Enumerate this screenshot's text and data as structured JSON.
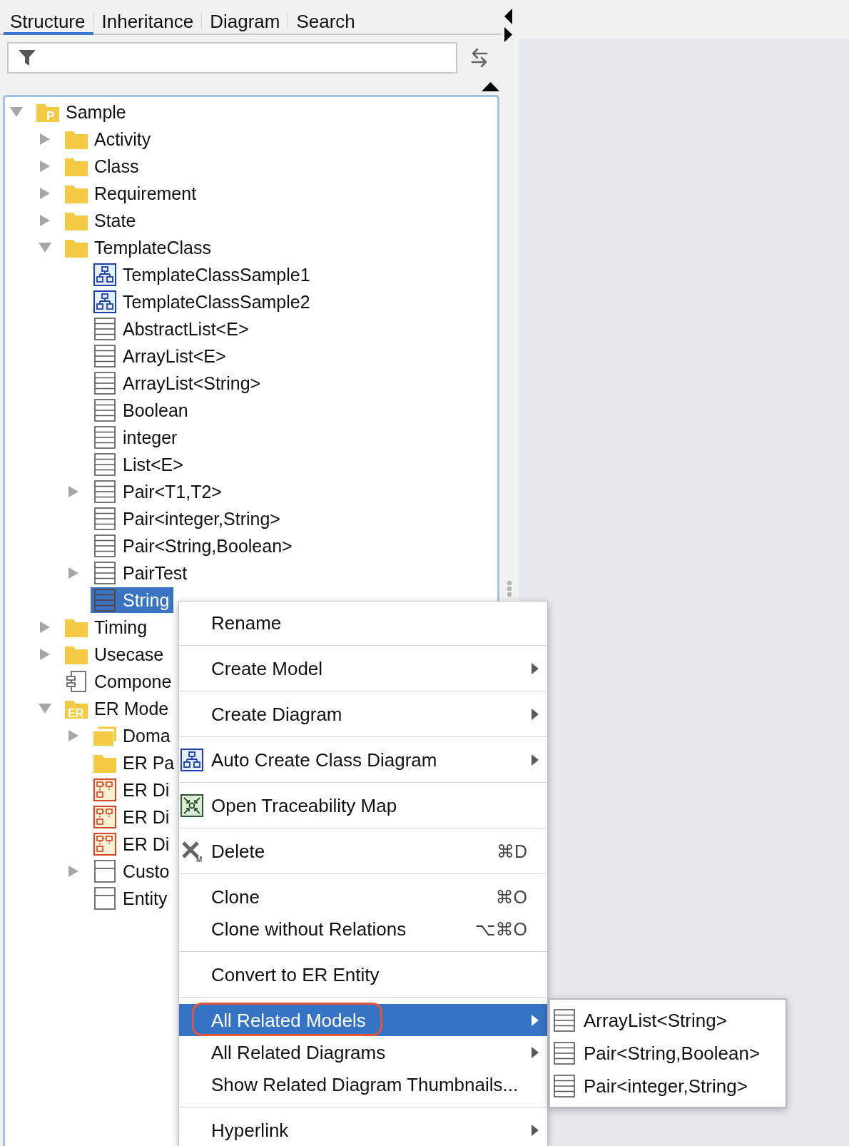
{
  "tabs": [
    {
      "label": "Structure",
      "selected": true
    },
    {
      "label": "Inheritance",
      "selected": false
    },
    {
      "label": "Diagram",
      "selected": false
    },
    {
      "label": "Search",
      "selected": false
    }
  ],
  "tree": [
    {
      "label": "Sample",
      "kind": "project",
      "icon_text": "P",
      "expanded": true,
      "selected": false,
      "children": [
        {
          "label": "Activity",
          "kind": "folder",
          "expanded": false,
          "selected": false
        },
        {
          "label": "Class",
          "kind": "folder",
          "expanded": false,
          "selected": false
        },
        {
          "label": "Requirement",
          "kind": "folder",
          "expanded": false,
          "selected": false
        },
        {
          "label": "State",
          "kind": "folder",
          "expanded": false,
          "selected": false
        },
        {
          "label": "TemplateClass",
          "kind": "folder",
          "expanded": true,
          "selected": false,
          "children": [
            {
              "label": "TemplateClassSample1",
              "kind": "diagram",
              "selected": false
            },
            {
              "label": "TemplateClassSample2",
              "kind": "diagram",
              "selected": false
            },
            {
              "label": "AbstractList<E>",
              "kind": "class",
              "selected": false
            },
            {
              "label": "ArrayList<E>",
              "kind": "class",
              "selected": false
            },
            {
              "label": "ArrayList<String>",
              "kind": "class",
              "selected": false
            },
            {
              "label": "Boolean",
              "kind": "class",
              "selected": false
            },
            {
              "label": "integer",
              "kind": "class",
              "selected": false
            },
            {
              "label": "List<E>",
              "kind": "class",
              "selected": false
            },
            {
              "label": "Pair<T1,T2>",
              "kind": "class",
              "expanded": false,
              "selected": false
            },
            {
              "label": "Pair<integer,String>",
              "kind": "class",
              "selected": false
            },
            {
              "label": "Pair<String,Boolean>",
              "kind": "class",
              "selected": false
            },
            {
              "label": "PairTest",
              "kind": "class",
              "expanded": false,
              "selected": false
            },
            {
              "label": "String",
              "kind": "class",
              "selected": true
            }
          ]
        },
        {
          "label": "Timing",
          "kind": "folder",
          "expanded": false,
          "selected": false
        },
        {
          "label": "Usecase",
          "kind": "folder",
          "expanded": false,
          "selected": false
        },
        {
          "label": "Compone",
          "kind": "component",
          "selected": false
        },
        {
          "label": "ER Mode",
          "kind": "ermodel",
          "icon_text": "ER",
          "expanded": true,
          "selected": false,
          "children": [
            {
              "label": "Doma",
              "kind": "domain",
              "expanded": false,
              "selected": false
            },
            {
              "label": "ER Pa",
              "kind": "folder",
              "selected": false
            },
            {
              "label": "ER Di",
              "kind": "erdiagram",
              "selected": false
            },
            {
              "label": "ER Di",
              "kind": "erdiagram",
              "selected": false
            },
            {
              "label": "ER Di",
              "kind": "erdiagram",
              "selected": false
            },
            {
              "label": "Custo",
              "kind": "entity",
              "expanded": false,
              "selected": false
            },
            {
              "label": "Entity",
              "kind": "entity",
              "selected": false
            }
          ]
        }
      ]
    }
  ],
  "context_menu": {
    "groups": [
      {
        "items": [
          {
            "label": "Rename",
            "kind": "plain",
            "submenu": false,
            "selected": false,
            "circled": false
          }
        ]
      },
      {
        "items": [
          {
            "label": "Create Model",
            "kind": "plain",
            "submenu": true,
            "selected": false,
            "circled": false
          }
        ]
      },
      {
        "items": [
          {
            "label": "Create Diagram",
            "kind": "plain",
            "submenu": true,
            "selected": false,
            "circled": false
          }
        ]
      },
      {
        "items": [
          {
            "label": "Auto Create Class Diagram",
            "kind": "diagram",
            "submenu": true,
            "selected": false,
            "circled": false
          }
        ]
      },
      {
        "items": [
          {
            "label": "Open Traceability Map",
            "kind": "traceability",
            "submenu": false,
            "selected": false,
            "circled": false
          }
        ]
      },
      {
        "items": [
          {
            "label": "Delete",
            "kind": "delete",
            "icon_text": "M",
            "shortcut": "⌘D",
            "submenu": false,
            "selected": false,
            "circled": false
          }
        ]
      },
      {
        "items": [
          {
            "label": "Clone",
            "kind": "plain",
            "shortcut": "⌘O",
            "submenu": false,
            "selected": false,
            "circled": false
          },
          {
            "label": "Clone without Relations",
            "kind": "plain",
            "shortcut": "⌥⌘O",
            "submenu": false,
            "selected": false,
            "circled": false
          }
        ]
      },
      {
        "items": [
          {
            "label": "Convert to ER Entity",
            "kind": "plain",
            "submenu": false,
            "selected": false,
            "circled": false
          }
        ]
      },
      {
        "items": [
          {
            "label": "All Related Models",
            "kind": "plain",
            "submenu": true,
            "selected": true,
            "circled": true
          },
          {
            "label": "All Related Diagrams",
            "kind": "plain",
            "submenu": true,
            "selected": false,
            "circled": false
          },
          {
            "label": "Show Related Diagram Thumbnails...",
            "kind": "plain",
            "submenu": false,
            "selected": false,
            "circled": false
          }
        ]
      },
      {
        "items": [
          {
            "label": "Hyperlink",
            "kind": "plain",
            "submenu": true,
            "selected": false,
            "circled": false
          }
        ]
      }
    ]
  },
  "submenu": {
    "items": [
      {
        "label": "ArrayList<String>",
        "selected": false
      },
      {
        "label": "Pair<String,Boolean>",
        "selected": false
      },
      {
        "label": "Pair<integer,String>",
        "selected": false
      }
    ]
  }
}
